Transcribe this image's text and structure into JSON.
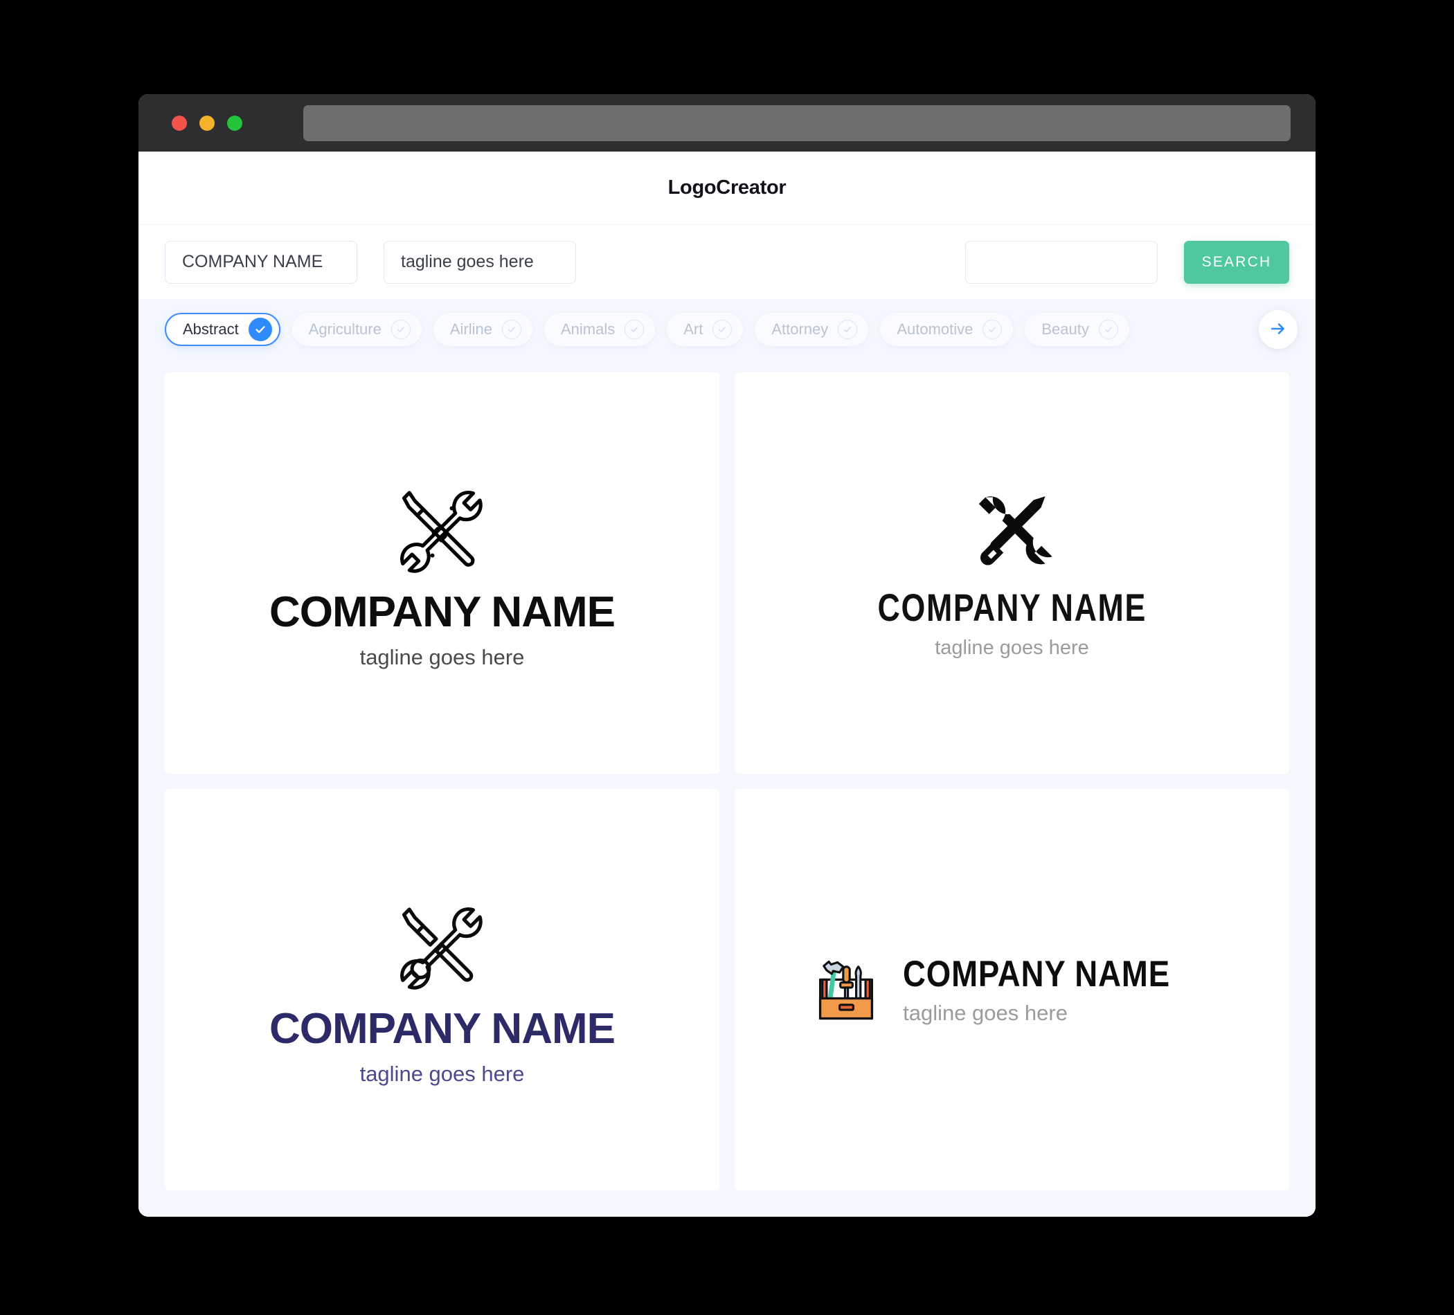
{
  "window": {
    "traffic_lights": [
      "close-red",
      "minimize-yellow",
      "maximize-green"
    ],
    "address_bar_value": "",
    "colors": {
      "titlebar": "#2e2e30",
      "addressbar": "#6e6e6e",
      "page_bg": "#f4f7fd",
      "accent_green": "#4ec89c",
      "accent_blue": "#2f8bfc"
    }
  },
  "header": {
    "title": "LogoCreator"
  },
  "search": {
    "company_value": "COMPANY NAME",
    "company_placeholder": "COMPANY NAME",
    "tagline_value": "tagline goes here",
    "tagline_placeholder": "tagline goes here",
    "keyword_value": "",
    "keyword_placeholder": "",
    "button_label": "SEARCH"
  },
  "categories": {
    "items": [
      {
        "label": "Abstract",
        "selected": true
      },
      {
        "label": "Agriculture",
        "selected": false
      },
      {
        "label": "Airline",
        "selected": false
      },
      {
        "label": "Animals",
        "selected": false
      },
      {
        "label": "Art",
        "selected": false
      },
      {
        "label": "Attorney",
        "selected": false
      },
      {
        "label": "Automotive",
        "selected": false
      },
      {
        "label": "Beauty",
        "selected": false
      }
    ],
    "next_icon": "arrow-right-icon"
  },
  "results": {
    "logos": [
      {
        "id": "logo-1",
        "mark": "crossed-wrench-screwdriver-outline-icon",
        "layout": "stacked",
        "company": "COMPANY NAME",
        "tagline": "tagline goes here",
        "company_color": "#0d0d0d",
        "tagline_color": "#4a4a4a"
      },
      {
        "id": "logo-2",
        "mark": "crossed-wrench-screwdriver-solid-icon",
        "layout": "stacked",
        "company": "COMPANY NAME",
        "tagline": "tagline goes here",
        "company_color": "#111111",
        "tagline_color": "#9b9b9b"
      },
      {
        "id": "logo-3",
        "mark": "crossed-wrench-screwdriver-outline-icon",
        "layout": "stacked",
        "company": "COMPANY NAME",
        "tagline": "tagline goes here",
        "company_color": "#2d2a68",
        "tagline_color": "#4a4a8c"
      },
      {
        "id": "logo-4",
        "mark": "toolbox-color-icon",
        "layout": "horizontal",
        "company": "COMPANY NAME",
        "tagline": "tagline goes here",
        "company_color": "#0d0d0d",
        "tagline_color": "#9b9b9b"
      }
    ]
  }
}
